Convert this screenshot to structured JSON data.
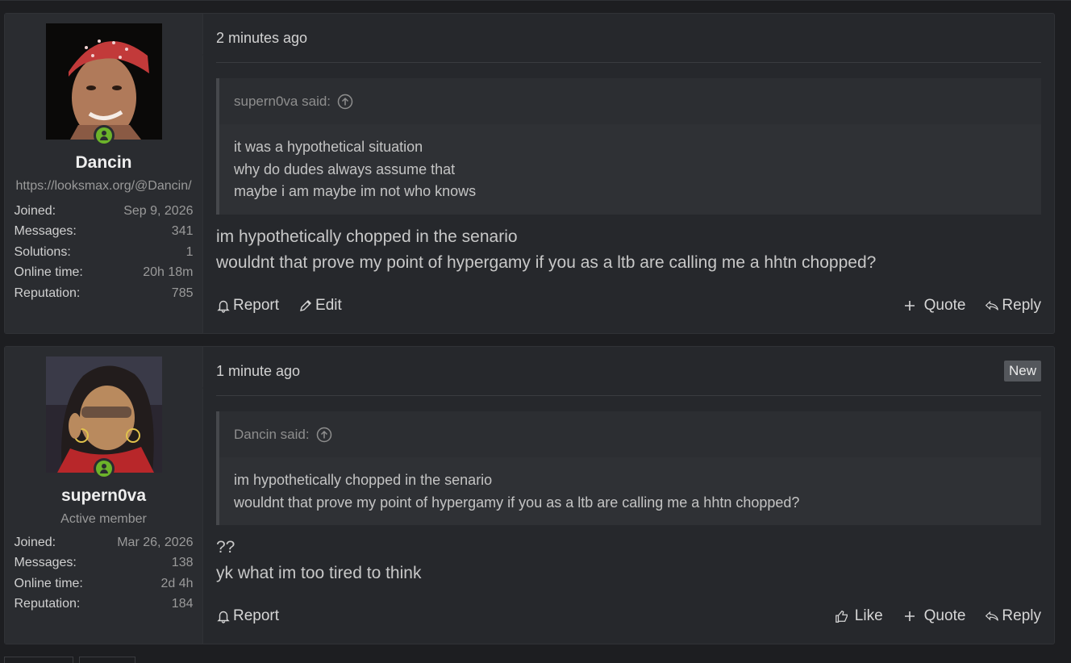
{
  "posts": [
    {
      "username": "Dancin",
      "user_title": "https://looksmax.org/@Dancin/",
      "stats": [
        {
          "label": "Joined:",
          "value": "Sep 9, 2026"
        },
        {
          "label": "Messages:",
          "value": "341"
        },
        {
          "label": "Solutions:",
          "value": "1"
        },
        {
          "label": "Online time:",
          "value": "20h 18m"
        },
        {
          "label": "Reputation:",
          "value": "785"
        }
      ],
      "time": "2 minutes ago",
      "quote_author": "supern0va said:",
      "quote_lines": [
        "it was a hypothetical situation",
        "why do dudes always assume that",
        "maybe i am maybe im not who knows"
      ],
      "content_lines": [
        "im hypothetically chopped in the senario",
        "wouldnt that prove my point of hypergamy if you as a ltb are calling me a hhtn chopped?"
      ],
      "actions_left": [
        "Report",
        "Edit"
      ],
      "actions_right": [
        "Quote",
        "Reply"
      ]
    },
    {
      "username": "supern0va",
      "user_title": "Active member",
      "stats": [
        {
          "label": "Joined:",
          "value": "Mar 26, 2026"
        },
        {
          "label": "Messages:",
          "value": "138"
        },
        {
          "label": "Online time:",
          "value": "2d 4h"
        },
        {
          "label": "Reputation:",
          "value": "184"
        }
      ],
      "time": "1 minute ago",
      "badge": "New",
      "quote_author": "Dancin said:",
      "quote_lines": [
        "im hypothetically chopped in the senario",
        "wouldnt that prove my point of hypergamy if you as a ltb are calling me a hhtn chopped?"
      ],
      "content_lines": [
        "??",
        "yk what im too tired to think"
      ],
      "actions_left": [
        "Report"
      ],
      "actions_right": [
        "Like",
        "Quote",
        "Reply"
      ]
    }
  ],
  "colors": {
    "online": "#6cb32a",
    "background": "#1d1e21",
    "post": "#26282c"
  }
}
